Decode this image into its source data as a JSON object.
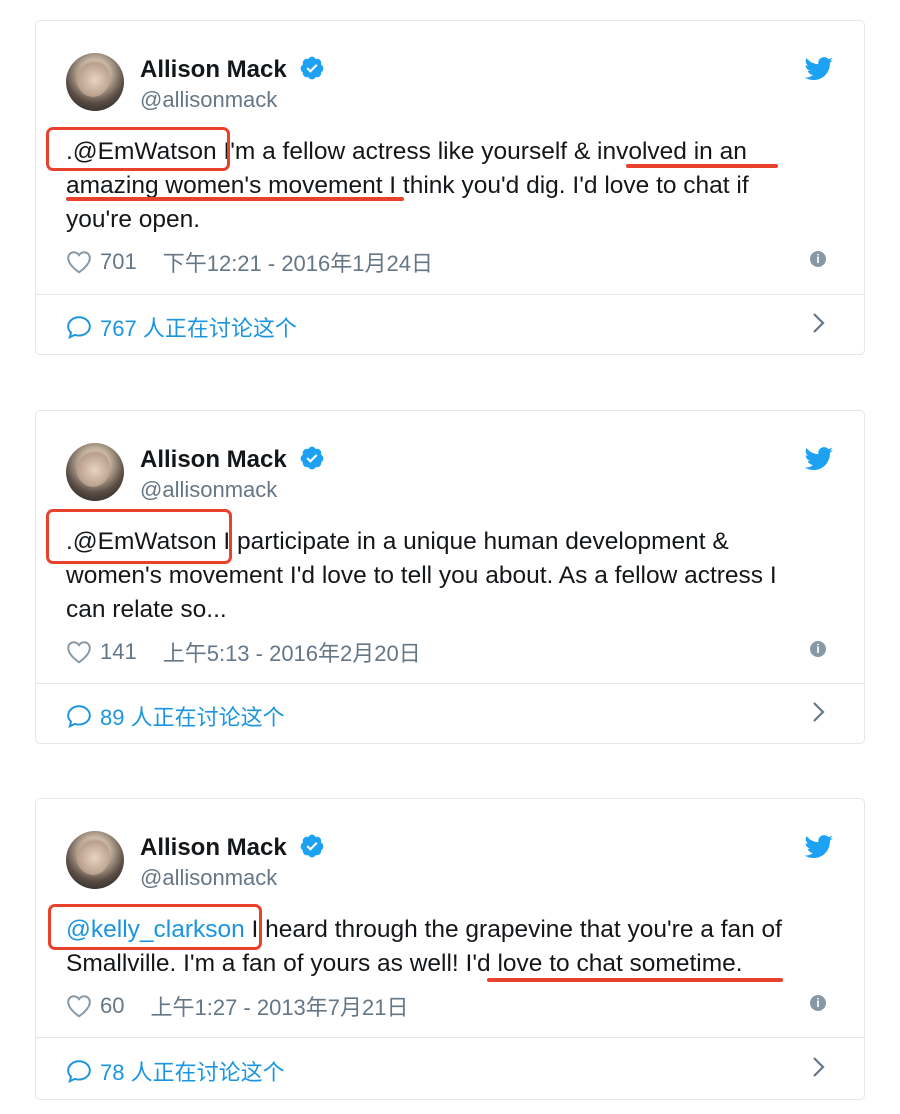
{
  "colors": {
    "accent": "#1b95e0",
    "highlight": "#e8412c",
    "muted": "#657786"
  },
  "tweets": [
    {
      "author": "Allison Mack",
      "handle": "@allisonmack",
      "mention": ".@EmWatson",
      "text_line1": " I'm a fellow actress like yourself & involved in an",
      "text_line2": "amazing women's movement I think you'd dig. I'd love to chat if",
      "text_line3": "you're open.",
      "likes": "701",
      "timestamp": "下午12:21 - 2016年1月24日",
      "discussion": "767 人正在讨论这个"
    },
    {
      "author": "Allison Mack",
      "handle": "@allisonmack",
      "mention": ".@EmWatson",
      "text_line1": " I participate in a unique human development &",
      "text_line2": "women's movement I'd love to tell you about. As a fellow actress I",
      "text_line3": "can relate so...",
      "likes": "141",
      "timestamp": "上午5:13 - 2016年2月20日",
      "discussion": "89 人正在讨论这个"
    },
    {
      "author": "Allison Mack",
      "handle": "@allisonmack",
      "mention": "@kelly_clarkson",
      "text_line1": " I heard through the grapevine that you're a fan of",
      "text_line2": "Smallville. I'm a fan of yours as well! I'd love to chat sometime.",
      "likes": "60",
      "timestamp": "上午1:27 - 2013年7月21日",
      "discussion": "78 人正在讨论这个"
    }
  ]
}
